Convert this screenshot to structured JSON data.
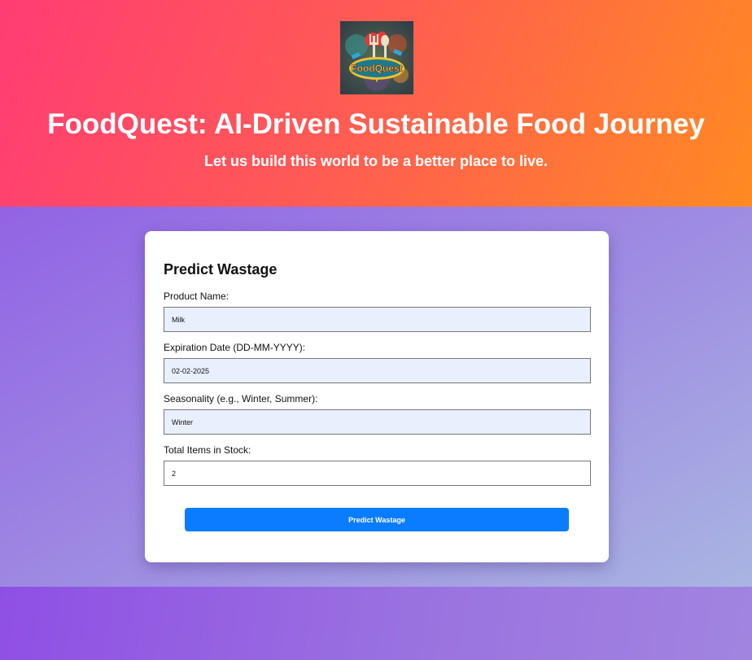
{
  "header": {
    "logo_text": "FoodQuest",
    "title": "FoodQuest: AI-Driven Sustainable Food Journey",
    "subtitle": "Let us build this world to be a better place to live.",
    "colors": {
      "start": "#ff3c74",
      "end": "#ff8a22"
    }
  },
  "form": {
    "title": "Predict Wastage",
    "fields": [
      {
        "label": "Product Name:",
        "value": "Milk"
      },
      {
        "label": "Expiration Date (DD-MM-YYYY):",
        "value": "02-02-2025"
      },
      {
        "label": "Seasonality (e.g., Winter, Summer):",
        "value": "Winter"
      },
      {
        "label": "Total Items in Stock:",
        "value": "2"
      }
    ],
    "submit_label": "Predict Wastage",
    "accent": "#0a7cff"
  }
}
